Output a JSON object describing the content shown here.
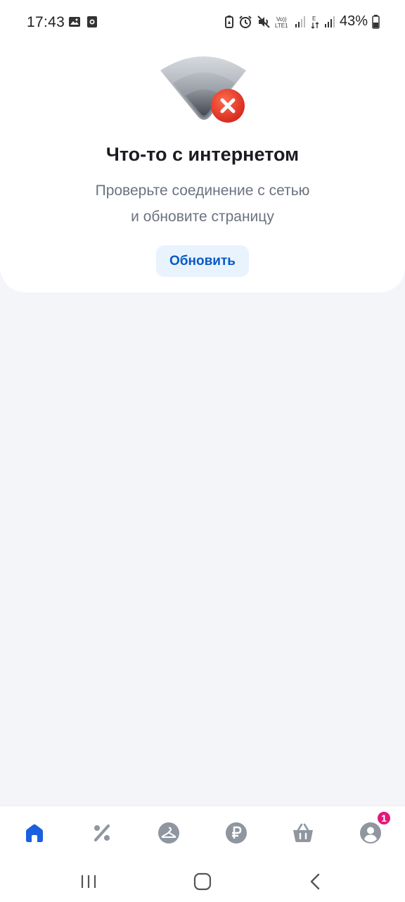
{
  "status_bar": {
    "time": "17:43",
    "left_icons": [
      "image-icon",
      "camera-icon"
    ],
    "right_icons": [
      "battery-saver-icon",
      "alarm-icon",
      "mute-icon",
      "volte-icon",
      "signal-icon",
      "data-icon",
      "signal-icon"
    ],
    "volte_label": "Vo))\nLTE1",
    "data_label": "E",
    "battery": "43%"
  },
  "error_card": {
    "illustration": "wifi-error-icon",
    "title": "Что-то с интернетом",
    "description_line1": "Проверьте соединение с сетью",
    "description_line2": "и обновите страницу",
    "refresh_label": "Обновить"
  },
  "bottom_nav": {
    "items": [
      {
        "id": "home",
        "icon": "home-icon",
        "active": true
      },
      {
        "id": "promo",
        "icon": "percent-icon",
        "active": false
      },
      {
        "id": "catalog",
        "icon": "hanger-icon",
        "active": false
      },
      {
        "id": "payment",
        "icon": "ruble-icon",
        "active": false
      },
      {
        "id": "cart",
        "icon": "basket-icon",
        "active": false
      },
      {
        "id": "profile",
        "icon": "profile-icon",
        "active": false,
        "badge": "1"
      }
    ]
  },
  "colors": {
    "accent": "#1a5fe0",
    "inactive_icon": "#8f969f",
    "badge": "#e4167a",
    "button_bg": "#e8f3fd",
    "button_text": "#0a59c8",
    "background": "#f3f5f9"
  }
}
